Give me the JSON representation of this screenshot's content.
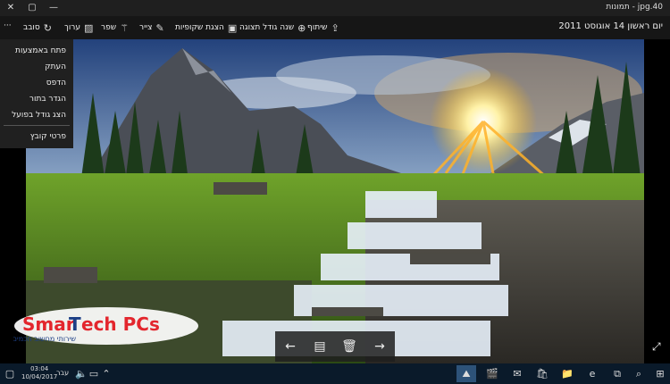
{
  "window": {
    "title": "40.jpg - תמונות",
    "min_glyph": "—",
    "max_glyph": "▢",
    "close_glyph": "✕"
  },
  "toolbar": {
    "date": "יום ראשון 14 אוגוסט 2011",
    "share": "שיתוף",
    "zoom": "שנה גודל תצוגה",
    "slideshow": "הצגת שקופיות",
    "draw": "צייר",
    "enhance": "שפר",
    "edit": "ערוך",
    "rotate": "סובב",
    "more": "···"
  },
  "menu": {
    "items": [
      "פתח באמצעות",
      "העתק",
      "הדפס",
      "הגדר בתור",
      "הצג גודל בפועל",
      "פרטי קובץ"
    ]
  },
  "logo": {
    "brand_left": "Smar",
    "brand_t": "T",
    "brand_right": "ech PCs",
    "tagline": "שירותי מחשוב חכמים"
  },
  "taskbar": {
    "time": "03:04",
    "date": "10/04/2017",
    "lang": "עבר"
  },
  "colors": {
    "taskbar": "#0a1a2a",
    "toolbar": "#161616",
    "active_task": "#2d5278",
    "logo_red": "#e3262d",
    "logo_blue": "#1d3f86"
  }
}
